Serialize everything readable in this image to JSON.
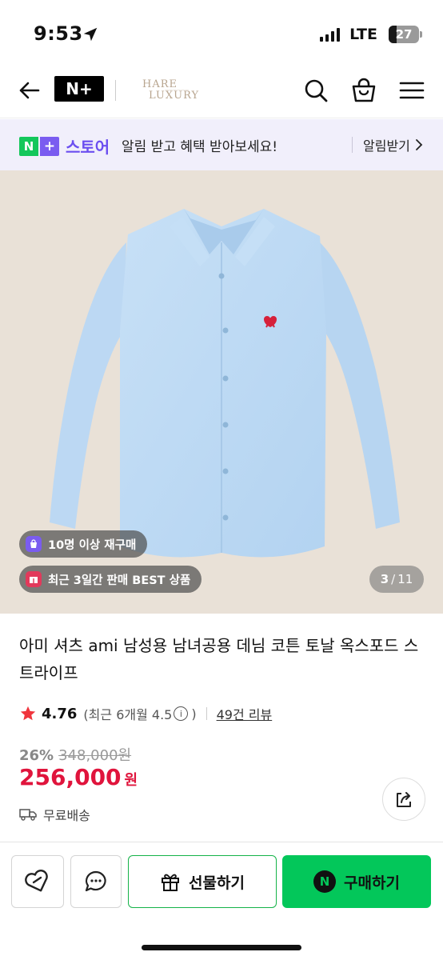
{
  "status_bar": {
    "time": "9:53",
    "network": "LTE",
    "battery": "27"
  },
  "nav": {
    "logo_text": "N+",
    "brand_logo": "HARE LUXURY",
    "icons": [
      "back-arrow-icon",
      "search-icon",
      "shopping-bag-icon",
      "menu-icon"
    ]
  },
  "banner": {
    "store_name": "스토어",
    "message": "알림 받고 혜택 받아보세요!",
    "cta": "알림받기"
  },
  "image": {
    "badges": [
      {
        "label": "10명 이상 재구매",
        "icon": "repurchase-bag-icon",
        "color": "#7a5cf0"
      },
      {
        "label": "최근 3일간 판매 BEST 상품",
        "icon": "gift-box-icon",
        "color": "#e2395b"
      }
    ],
    "pager": {
      "current": "3",
      "total": "11"
    }
  },
  "product": {
    "title": "아미 셔츠 ami 남성용 남녀공용 데님 코튼 토날 옥스포드 스트라이프",
    "rating": "4.76",
    "rating_sub": "(최근 6개월 4.5",
    "rating_sub_close": ")",
    "review_link": "49건 리뷰",
    "discount_rate": "26%",
    "original_price": "348,000원",
    "sale_price": "256,000",
    "sale_unit": "원",
    "delivery": "무료배송"
  },
  "bottom_bar": {
    "gift_label": "선물하기",
    "buy_label": "구매하기",
    "buy_icon_text": "N"
  },
  "colors": {
    "accent_green": "#03c75a",
    "price_red": "#e0143c",
    "store_purple": "#6b4ef0",
    "banner_bg": "#f1effb",
    "image_bg": "#e9e1d7"
  }
}
